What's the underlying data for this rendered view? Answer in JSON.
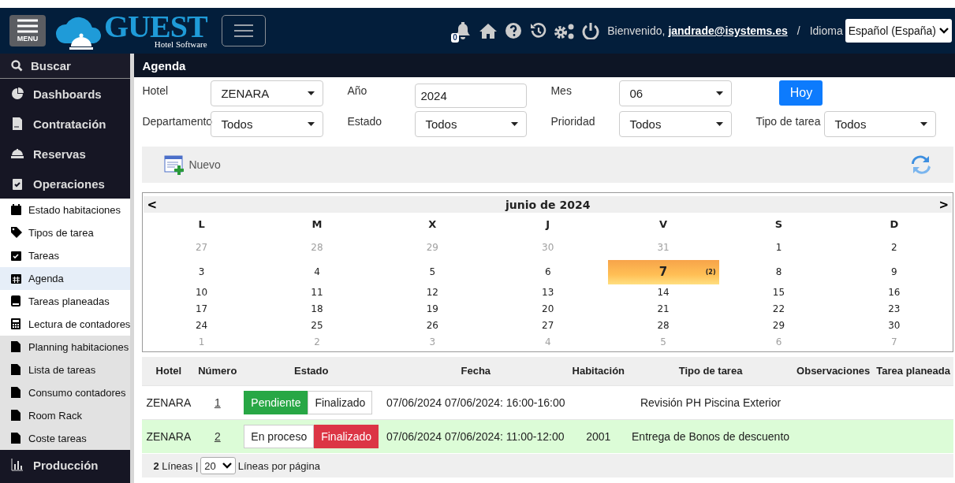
{
  "header": {
    "menu_label": "MENU",
    "logo_title": "GUEST",
    "logo_subtitle": "Hotel Software",
    "notifications": "0",
    "welcome": "Bienvenido,",
    "user": "jandrade@isystems.es",
    "separator": "/",
    "language_label": "Idioma",
    "language": "Español (España)"
  },
  "sidebar": {
    "search": "Buscar",
    "items": [
      {
        "label": "Dashboards"
      },
      {
        "label": "Contratación"
      },
      {
        "label": "Reservas"
      },
      {
        "label": "Operaciones",
        "children": [
          {
            "label": "Estado habitaciones",
            "kind": "page",
            "selected": false
          },
          {
            "label": "Tipos de tarea",
            "kind": "page",
            "selected": false
          },
          {
            "label": "Tareas",
            "kind": "page",
            "selected": false
          },
          {
            "label": "Agenda",
            "kind": "page",
            "selected": true
          },
          {
            "label": "Tareas planeadas",
            "kind": "page",
            "selected": false
          },
          {
            "label": "Lectura de contadores",
            "kind": "page",
            "selected": false
          },
          {
            "label": "Planning habitaciones",
            "kind": "report",
            "selected": false
          },
          {
            "label": "Lista de tareas",
            "kind": "report",
            "selected": false
          },
          {
            "label": "Consumo contadores",
            "kind": "report",
            "selected": false
          },
          {
            "label": "Room Rack",
            "kind": "report",
            "selected": false
          },
          {
            "label": "Coste tareas",
            "kind": "report",
            "selected": false
          }
        ]
      },
      {
        "label": "Producción"
      }
    ]
  },
  "page_title": "Agenda",
  "filters": [
    {
      "label": "Hotel",
      "value": "ZENARA",
      "kind": "select"
    },
    {
      "label": "Año",
      "value": "2024",
      "kind": "input"
    },
    {
      "label": "Mes",
      "value": "06",
      "kind": "select"
    },
    {
      "label": "Departamento",
      "value": "Todos",
      "kind": "select"
    },
    {
      "label": "Estado",
      "value": "Todos",
      "kind": "select"
    },
    {
      "label": "Prioridad",
      "value": "Todos",
      "kind": "select"
    },
    {
      "label": "Tipo de tarea",
      "value": "Todos",
      "kind": "select"
    }
  ],
  "today_button": "Hoy",
  "toolbar": {
    "new_label": "Nuevo"
  },
  "calendar": {
    "title": "junio de 2024",
    "prev": "<",
    "next": ">",
    "weekdays": [
      "L",
      "M",
      "X",
      "J",
      "V",
      "S",
      "D"
    ],
    "weeks": [
      [
        {
          "day": "27",
          "outside": true,
          "selected": false
        },
        {
          "day": "28",
          "outside": true,
          "selected": false
        },
        {
          "day": "29",
          "outside": true,
          "selected": false
        },
        {
          "day": "30",
          "outside": true,
          "selected": false
        },
        {
          "day": "31",
          "outside": true,
          "selected": false
        },
        {
          "day": "1",
          "outside": false,
          "selected": false
        },
        {
          "day": "2",
          "outside": false,
          "selected": false
        }
      ],
      [
        {
          "day": "3",
          "outside": false,
          "selected": false
        },
        {
          "day": "4",
          "outside": false,
          "selected": false
        },
        {
          "day": "5",
          "outside": false,
          "selected": false
        },
        {
          "day": "6",
          "outside": false,
          "selected": false
        },
        {
          "day": "7",
          "outside": false,
          "selected": true,
          "count": "(2)"
        },
        {
          "day": "8",
          "outside": false,
          "selected": false
        },
        {
          "day": "9",
          "outside": false,
          "selected": false
        }
      ],
      [
        {
          "day": "10",
          "outside": false,
          "selected": false
        },
        {
          "day": "11",
          "outside": false,
          "selected": false
        },
        {
          "day": "12",
          "outside": false,
          "selected": false
        },
        {
          "day": "13",
          "outside": false,
          "selected": false
        },
        {
          "day": "14",
          "outside": false,
          "selected": false
        },
        {
          "day": "15",
          "outside": false,
          "selected": false
        },
        {
          "day": "16",
          "outside": false,
          "selected": false
        }
      ],
      [
        {
          "day": "17",
          "outside": false,
          "selected": false
        },
        {
          "day": "18",
          "outside": false,
          "selected": false
        },
        {
          "day": "19",
          "outside": false,
          "selected": false
        },
        {
          "day": "20",
          "outside": false,
          "selected": false
        },
        {
          "day": "21",
          "outside": false,
          "selected": false
        },
        {
          "day": "22",
          "outside": false,
          "selected": false
        },
        {
          "day": "23",
          "outside": false,
          "selected": false
        }
      ],
      [
        {
          "day": "24",
          "outside": false,
          "selected": false
        },
        {
          "day": "25",
          "outside": false,
          "selected": false
        },
        {
          "day": "26",
          "outside": false,
          "selected": false
        },
        {
          "day": "27",
          "outside": false,
          "selected": false
        },
        {
          "day": "28",
          "outside": false,
          "selected": false
        },
        {
          "day": "29",
          "outside": false,
          "selected": false
        },
        {
          "day": "30",
          "outside": false,
          "selected": false
        }
      ],
      [
        {
          "day": "1",
          "outside": true,
          "selected": false
        },
        {
          "day": "2",
          "outside": true,
          "selected": false
        },
        {
          "day": "3",
          "outside": true,
          "selected": false
        },
        {
          "day": "4",
          "outside": true,
          "selected": false
        },
        {
          "day": "5",
          "outside": true,
          "selected": false
        },
        {
          "day": "6",
          "outside": true,
          "selected": false
        },
        {
          "day": "7",
          "outside": true,
          "selected": false
        }
      ]
    ]
  },
  "table": {
    "columns": [
      "Hotel",
      "Número",
      "Estado",
      "Fecha",
      "Habitación",
      "Tipo de tarea",
      "Observaciones",
      "Tarea planeada"
    ],
    "rows": [
      {
        "hotel": "ZENARA",
        "number": "1",
        "status": [
          {
            "label": "Pendiente",
            "kind": "pending",
            "selected": true
          },
          {
            "label": "Finalizado",
            "kind": "done",
            "selected": false
          }
        ],
        "date": "07/06/2024 07/06/2024: 16:00-16:00",
        "task_type": "Revisión PH Piscina Exterior",
        "selected": false
      },
      {
        "hotel": "ZENARA",
        "number": "2",
        "status": [
          {
            "label": "En proceso",
            "kind": "progress",
            "selected": false
          },
          {
            "label": "Finalizado",
            "kind": "done",
            "selected": true
          }
        ],
        "date": "07/06/2024 07/06/2024: 11:00-12:00",
        "room": "2001",
        "task_type": "Entrega de Bonos de descuento",
        "selected": true
      }
    ]
  },
  "footer": {
    "count": "**2** Líneas |",
    "page_size": "20",
    "page_size_label": "Líneas por página"
  }
}
